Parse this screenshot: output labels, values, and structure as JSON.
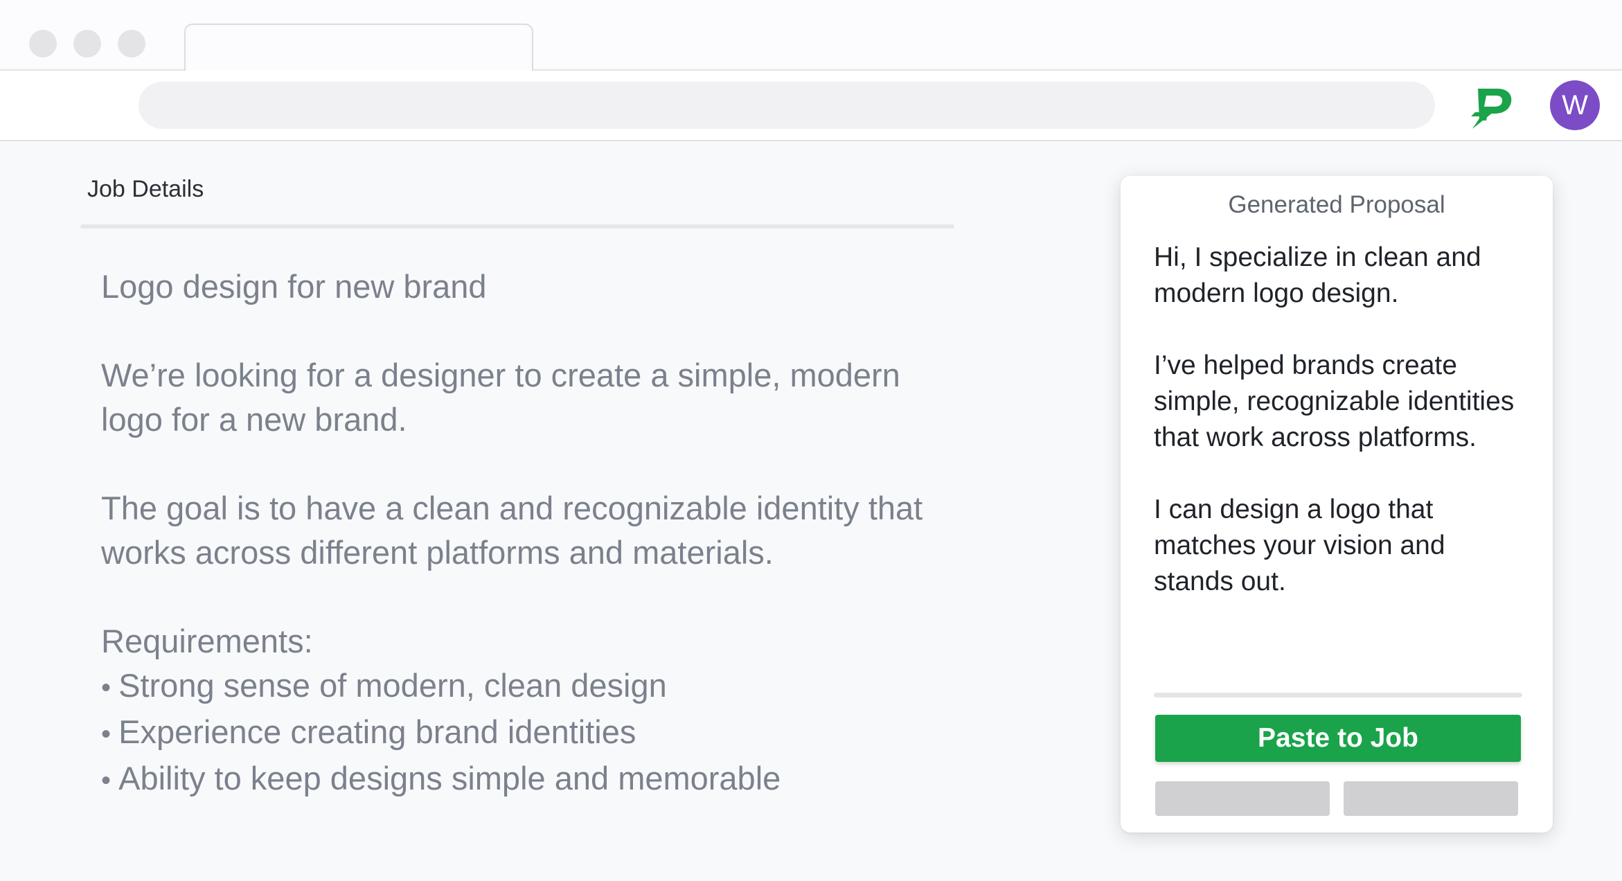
{
  "window": {
    "traffic_lights": [
      "close-icon",
      "minimize-icon",
      "zoom-icon"
    ],
    "tab_title": "",
    "address_value": ""
  },
  "toolbar": {
    "extension_icon": "paste-logo-icon",
    "extension_color": "#1aa34a",
    "avatar_letter": "W",
    "avatar_color": "#7b4cc6"
  },
  "job": {
    "header": "Job Details",
    "title": "Logo design for new brand",
    "description": "We’re looking for a designer to create a simple, modern logo for a new brand.",
    "goal": "The goal is to have a clean and recognizable identity that works across different platforms and materials.",
    "requirements_label": "Requirements:",
    "requirements": [
      "Strong sense of modern, clean design",
      "Experience creating brand identities",
      "Ability to keep designs simple and memorable"
    ]
  },
  "proposal": {
    "title": "Generated Proposal",
    "paragraphs": [
      "Hi, I specialize in clean and modern logo design.",
      "I’ve helped brands create simple, recognizable identities that work across platforms.",
      "I can design a logo that matches your vision and stands out."
    ],
    "paste_button": "Paste to Job",
    "accent_color": "#1aa34a"
  }
}
